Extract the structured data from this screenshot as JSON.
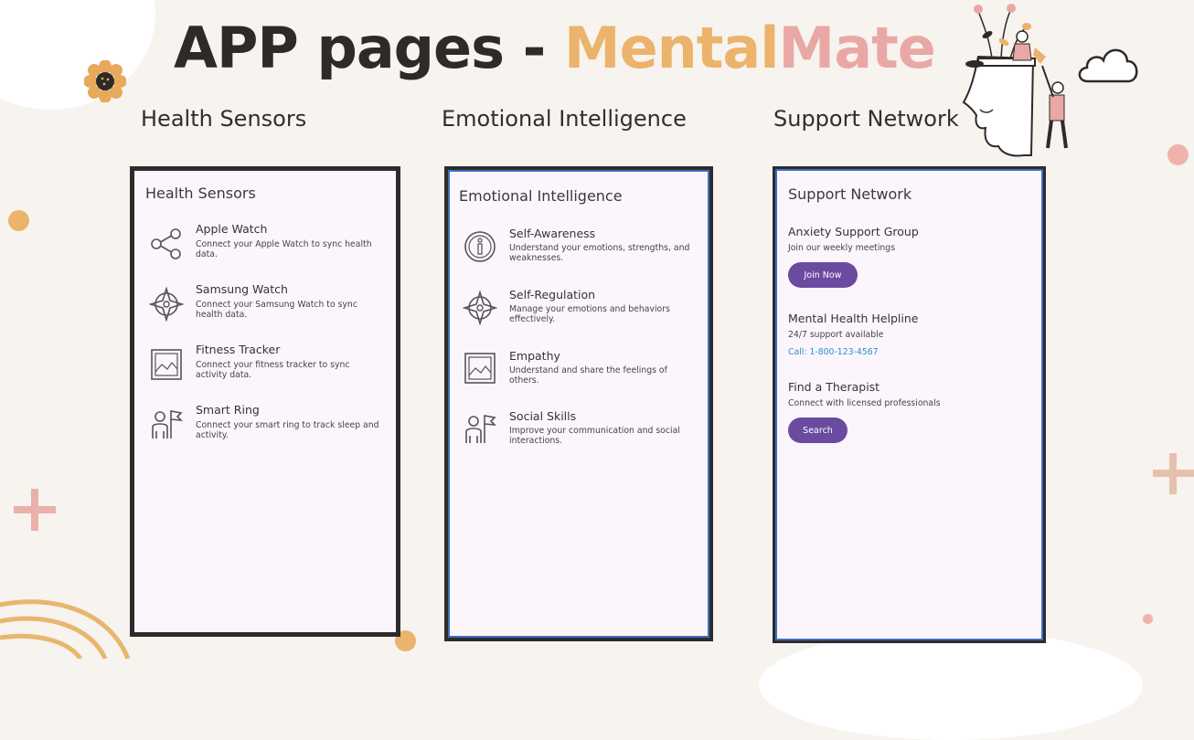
{
  "slide": {
    "title_part1": "APP pages - ",
    "title_part2": "Mental",
    "title_part3": "Mate"
  },
  "sections": {
    "health_heading": "Health Sensors",
    "emotional_heading": "Emotional Intelligence",
    "support_heading": "Support Network"
  },
  "health_screen": {
    "title": "Health Sensors",
    "items": [
      {
        "name": "Apple Watch",
        "desc": "Connect your Apple Watch to sync health data.",
        "icon": "share-icon"
      },
      {
        "name": "Samsung Watch",
        "desc": "Connect your Samsung Watch to sync health data.",
        "icon": "compass-icon"
      },
      {
        "name": "Fitness Tracker",
        "desc": "Connect your fitness tracker to sync activity data.",
        "icon": "image-icon"
      },
      {
        "name": "Smart Ring",
        "desc": "Connect your smart ring to track sleep and activity.",
        "icon": "person-flag-icon"
      }
    ]
  },
  "emotional_screen": {
    "title": "Emotional Intelligence",
    "items": [
      {
        "name": "Self-Awareness",
        "desc": "Understand your emotions, strengths, and weaknesses.",
        "icon": "info-icon"
      },
      {
        "name": "Self-Regulation",
        "desc": "Manage your emotions and behaviors effectively.",
        "icon": "compass-icon"
      },
      {
        "name": "Empathy",
        "desc": "Understand and share the feelings of others.",
        "icon": "image-icon"
      },
      {
        "name": "Social Skills",
        "desc": "Improve your communication and social interactions.",
        "icon": "person-flag-icon"
      }
    ]
  },
  "support_screen": {
    "title": "Support Network",
    "group": {
      "title": "Anxiety Support Group",
      "sub": "Join our weekly meetings",
      "button": "Join Now"
    },
    "helpline": {
      "title": "Mental Health Helpline",
      "sub": "24/7 support available",
      "link": "Call: 1-800-123-4567"
    },
    "therapist": {
      "title": "Find a Therapist",
      "sub": "Connect with licensed professionals",
      "button": "Search"
    }
  },
  "colors": {
    "background": "#f7f3ee",
    "accent_orange": "#ebb36b",
    "accent_pink": "#e9a8a5",
    "button_purple": "#6a4ba0",
    "link_blue": "#2a8fd0",
    "screen_bg": "#fcf6fc"
  }
}
